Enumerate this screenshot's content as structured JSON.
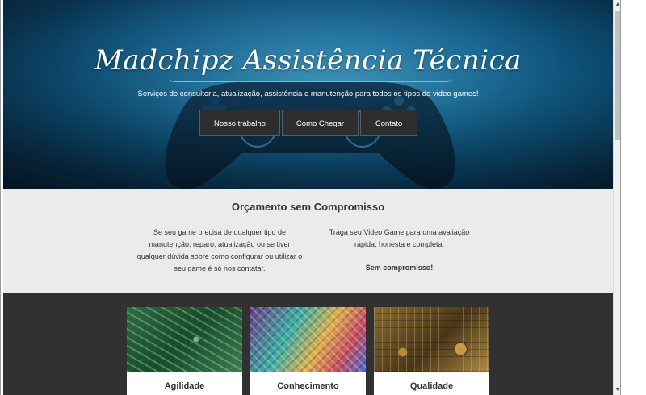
{
  "hero": {
    "title": "Madchipz Assistência Técnica",
    "subtitle": "Serviços de consultoria, atualização, assistência e manutenção para todos os tipos de video games!",
    "nav": [
      {
        "label": "Nosso trabalho"
      },
      {
        "label": "Como Chegar"
      },
      {
        "label": "Contato"
      }
    ]
  },
  "quote": {
    "heading": "Orçamento sem Compromisso",
    "left_text": "Se seu game precisa de qualquer tipo de manutenção, reparo, atualização ou se tiver qualquer dúvida sobre como configurar ou utilizar o seu game é só nos contatar.",
    "right_text": "Traga seu Video Game para uma avaliação rápida, honesta e completa.",
    "right_bold": "Sem compromisso!"
  },
  "features": [
    {
      "label": "Agilidade"
    },
    {
      "label": "Conhecimento"
    },
    {
      "label": "Qualidade"
    }
  ],
  "colors": {
    "hero_blue": "#1c7fb3",
    "nav_bg": "#2e2e2e",
    "quote_bg": "#ebebeb",
    "features_bg": "#313131"
  }
}
